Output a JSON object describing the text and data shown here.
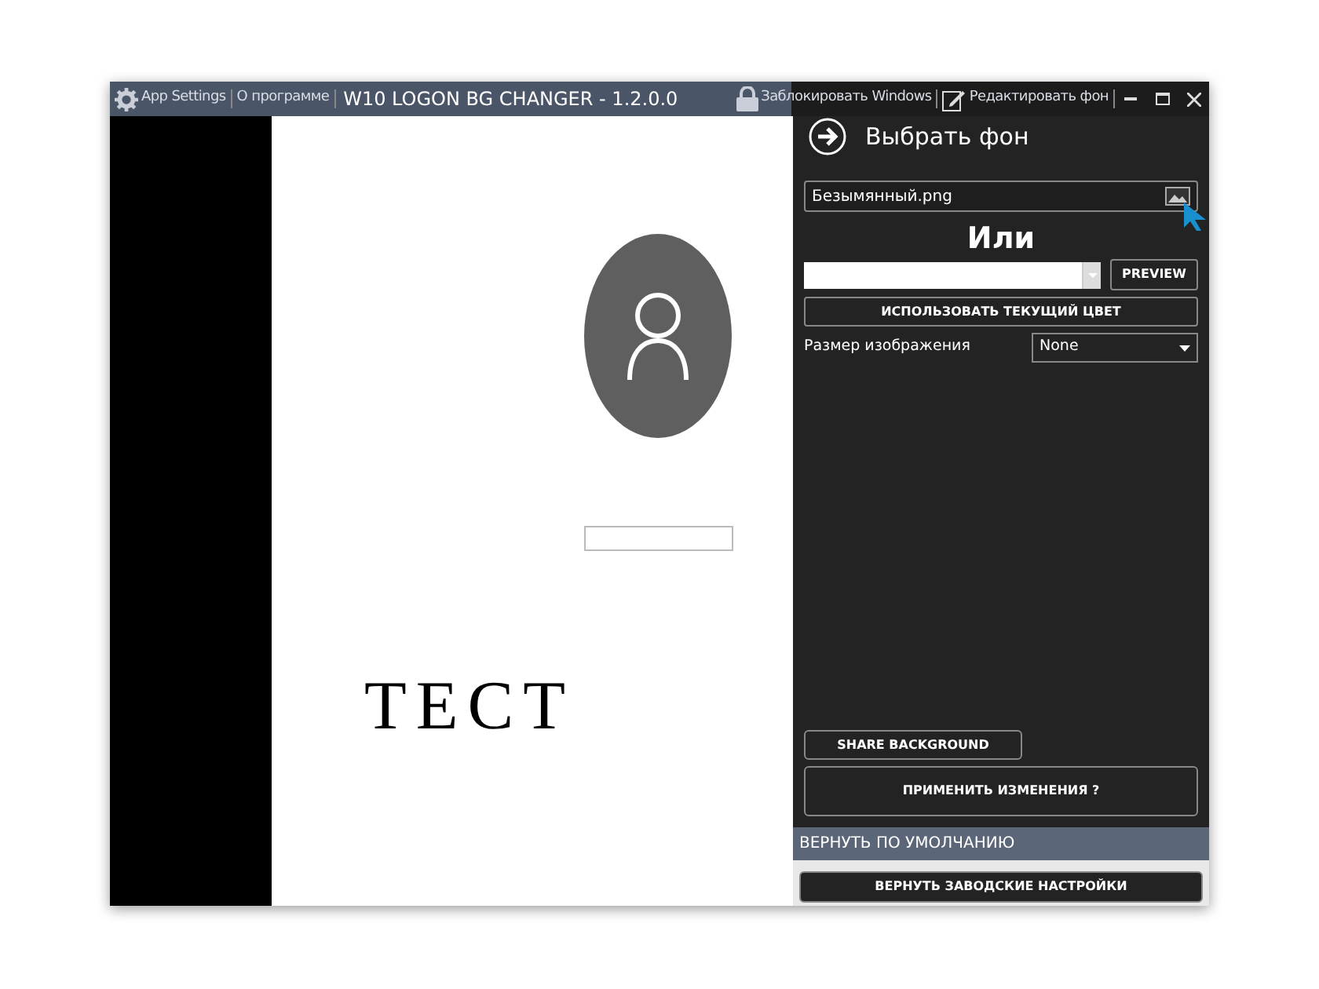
{
  "title_bar": {
    "items": [
      {
        "kind": "settings",
        "label": "App Settings"
      },
      {
        "kind": "plain",
        "label": "О программе"
      }
    ],
    "title": "W10 LOGON BG CHANGER - 1.2.0.0",
    "actions": [
      {
        "kind": "lock",
        "label": "Заблокировать Windows"
      },
      {
        "kind": "edit",
        "label": "Редактировать фон"
      }
    ]
  },
  "preview": {
    "caption": "ТЕСТ"
  },
  "panel": {
    "heading": "Выбрать фон",
    "file_field": {
      "value": "Безымянный.png"
    },
    "or_label": "Или",
    "preview_button": "PREVIEW",
    "use_color_button": "ИСПОЛЬЗОВАТЬ ТЕКУЩИЙ ЦВЕТ",
    "size_label": "Размер изображения",
    "size_select": {
      "value": "None"
    },
    "share_button": "SHARE BACKGROUND",
    "apply_button": "ПРИМЕНИТЬ ИЗМЕНЕНИЯ ?"
  },
  "defaults": {
    "heading": "ВЕРНУТЬ ПО УМОЛЧАНИЮ",
    "reset_button": "ВЕРНУТЬ ЗАВОДСКИЕ НАСТРОЙКИ"
  }
}
